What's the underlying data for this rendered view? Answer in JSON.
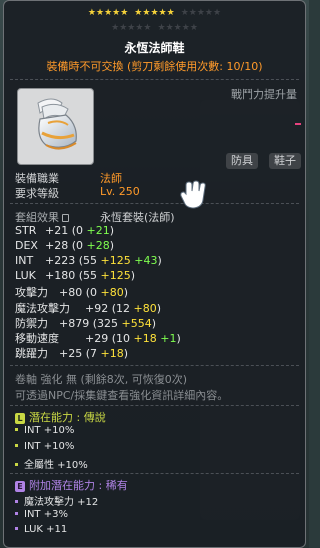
{
  "star_force": {
    "filled": 10,
    "total": 25
  },
  "item": {
    "name": "永恆法師鞋",
    "note": "裝備時不可交換 (剪刀剩餘使用次數: 10/10)"
  },
  "side_panel": {
    "label": "戰鬥力提升量"
  },
  "tags": {
    "type": "防具",
    "subtype": "鞋子"
  },
  "requirements": {
    "job_label": "裝備職業",
    "job_value": "法師",
    "level_label": "要求等級",
    "level_value": "Lv. 250"
  },
  "set_effect": {
    "label": "套組效果",
    "name": "永恆套裝(法師)"
  },
  "stats": [
    {
      "label": "STR",
      "total": "+21",
      "parts": [
        [
          "(0 ",
          "plain"
        ],
        [
          "+21",
          "green"
        ],
        [
          ")",
          "plain"
        ]
      ]
    },
    {
      "label": "DEX",
      "total": "+28",
      "parts": [
        [
          "(0 ",
          "plain"
        ],
        [
          "+28",
          "green"
        ],
        [
          ")",
          "plain"
        ]
      ]
    },
    {
      "label": "INT",
      "total": "+223",
      "parts": [
        [
          "(55 ",
          "plain"
        ],
        [
          "+125",
          "yellow"
        ],
        [
          " ",
          "plain"
        ],
        [
          "+43",
          "green"
        ],
        [
          ")",
          "plain"
        ]
      ]
    },
    {
      "label": "LUK",
      "total": "+180",
      "parts": [
        [
          "(55 ",
          "plain"
        ],
        [
          "+125",
          "yellow"
        ],
        [
          ")",
          "plain"
        ]
      ]
    },
    {
      "label": "攻擊力",
      "total": "+80",
      "parts": [
        [
          "(0 ",
          "plain"
        ],
        [
          "+80",
          "yellow"
        ],
        [
          ")",
          "plain"
        ]
      ]
    },
    {
      "label": "魔法攻擊力",
      "total": "+92",
      "parts": [
        [
          "(12 ",
          "plain"
        ],
        [
          "+80",
          "yellow"
        ],
        [
          ")",
          "plain"
        ]
      ]
    },
    {
      "label": "防禦力",
      "total": "+879",
      "parts": [
        [
          "(325 ",
          "plain"
        ],
        [
          "+554",
          "yellow"
        ],
        [
          ")",
          "plain"
        ]
      ]
    },
    {
      "label": "移動速度",
      "total": "+29",
      "parts": [
        [
          "(10 ",
          "plain"
        ],
        [
          "+18",
          "yellow"
        ],
        [
          " ",
          "plain"
        ],
        [
          "+1",
          "green"
        ],
        [
          ")",
          "plain"
        ]
      ]
    },
    {
      "label": "跳躍力",
      "total": "+25",
      "parts": [
        [
          "(7 ",
          "plain"
        ],
        [
          "+18",
          "yellow"
        ],
        [
          ")",
          "plain"
        ]
      ]
    }
  ],
  "scroll_info": {
    "line1": "卷軸 強化 無 (剩餘8次, 可恢復0次)",
    "line2": "可透過NPC/採集鍵查看強化資訊詳細內容。"
  },
  "potential": {
    "header": "潛在能力 : 傳說",
    "badge": "L",
    "lines": [
      "INT +10%",
      "INT +10%",
      "全屬性 +10%"
    ]
  },
  "additional_potential": {
    "header": "附加潛在能力 : 稀有",
    "badge": "E",
    "lines": [
      "魔法攻擊力 +12",
      "INT +3%",
      "LUK +11"
    ]
  },
  "colors": {
    "star_on": "#f5d23a",
    "star_off": "#3e4248",
    "name": "#ffffff",
    "note": "#ff9a2a",
    "job_value": "#ff9a2a",
    "level_value": "#ff9a2a",
    "potential_legend": "#c9d844",
    "additional_rare": "#b083e6"
  },
  "icons": {
    "item_icon": "winged-shoe-icon",
    "cursor": "white-glove-hand-icon",
    "lock": "lock-icon"
  }
}
